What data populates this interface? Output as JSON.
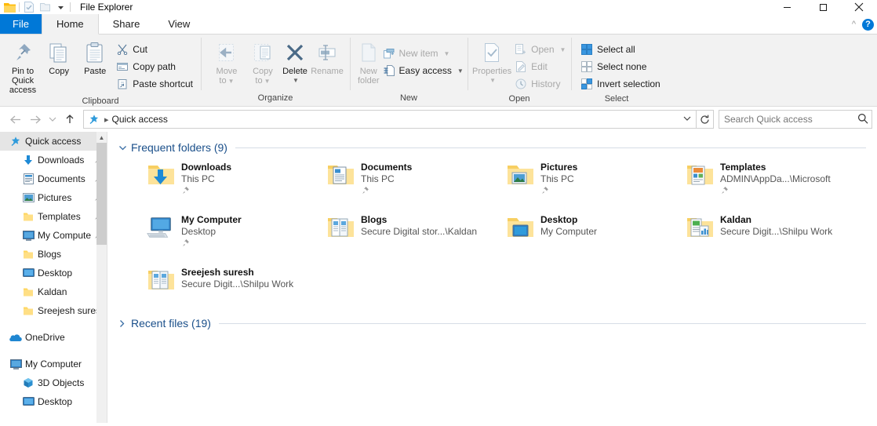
{
  "window": {
    "title": "File Explorer",
    "quick_access_toolbar": [
      {
        "name": "explorer-icon",
        "glyph": "folder"
      },
      {
        "name": "properties-qat-icon",
        "glyph": "check-doc"
      },
      {
        "name": "new-folder-qat-icon",
        "glyph": "folder-blank"
      },
      {
        "name": "customize-qat-icon",
        "glyph": "caret-down"
      }
    ],
    "controls": {
      "minimize": "minimize",
      "maximize": "maximize",
      "close": "close",
      "collapse_ribbon": "chevron-up",
      "help": "?"
    }
  },
  "tabs": [
    {
      "label": "File",
      "state": "file-menu"
    },
    {
      "label": "Home",
      "state": "active"
    },
    {
      "label": "Share",
      "state": "normal"
    },
    {
      "label": "View",
      "state": "normal"
    }
  ],
  "ribbon": {
    "groups": [
      {
        "name": "Clipboard",
        "label": "Clipboard",
        "big_buttons": [
          {
            "label_line1": "Pin to Quick",
            "label_line2": "access",
            "icon": "pin-icon",
            "enabled": true
          },
          {
            "label_line1": "Copy",
            "label_line2": "",
            "icon": "copy-icon",
            "enabled": true
          },
          {
            "label_line1": "Paste",
            "label_line2": "",
            "icon": "paste-icon",
            "enabled": true
          }
        ],
        "small_buttons": [
          {
            "label": "Cut",
            "icon": "scissors-icon",
            "enabled": true,
            "caret": false
          },
          {
            "label": "Copy path",
            "icon": "copy-path-icon",
            "enabled": true,
            "caret": false
          },
          {
            "label": "Paste shortcut",
            "icon": "paste-shortcut-icon",
            "enabled": true,
            "caret": false
          }
        ]
      },
      {
        "name": "Organize",
        "label": "Organize",
        "big_buttons": [
          {
            "label_line1": "Move",
            "label_line2": "to",
            "icon": "move-to-icon",
            "enabled": false,
            "caret": true
          },
          {
            "label_line1": "Copy",
            "label_line2": "to",
            "icon": "copy-to-icon",
            "enabled": false,
            "caret": true
          },
          {
            "label_line1": "Delete",
            "label_line2": "",
            "icon": "delete-icon",
            "enabled": true,
            "caret": true
          },
          {
            "label_line1": "Rename",
            "label_line2": "",
            "icon": "rename-icon",
            "enabled": false,
            "caret": false
          }
        ],
        "small_buttons": []
      },
      {
        "name": "New",
        "label": "New",
        "big_buttons": [
          {
            "label_line1": "New",
            "label_line2": "folder",
            "icon": "new-folder-icon",
            "enabled": false
          }
        ],
        "small_buttons": [
          {
            "label": "New item",
            "icon": "new-item-icon",
            "enabled": false,
            "caret": true
          },
          {
            "label": "Easy access",
            "icon": "easy-access-icon",
            "enabled": true,
            "caret": true
          }
        ]
      },
      {
        "name": "Open",
        "label": "Open",
        "big_buttons": [
          {
            "label_line1": "Properties",
            "label_line2": "",
            "icon": "properties-icon",
            "enabled": false,
            "caret": true
          }
        ],
        "small_buttons": [
          {
            "label": "Open",
            "icon": "open-icon",
            "enabled": false,
            "caret": true
          },
          {
            "label": "Edit",
            "icon": "edit-icon",
            "enabled": false,
            "caret": false
          },
          {
            "label": "History",
            "icon": "history-icon",
            "enabled": false,
            "caret": false
          }
        ]
      },
      {
        "name": "Select",
        "label": "Select",
        "big_buttons": [],
        "small_buttons": [
          {
            "label": "Select all",
            "icon": "select-all-icon",
            "enabled": true,
            "caret": false
          },
          {
            "label": "Select none",
            "icon": "select-none-icon",
            "enabled": true,
            "caret": false
          },
          {
            "label": "Invert selection",
            "icon": "invert-selection-icon",
            "enabled": true,
            "caret": false
          }
        ]
      }
    ]
  },
  "navbar": {
    "back": "back-arrow",
    "forward": "forward-arrow",
    "recent": "chevron-down",
    "up": "up-arrow",
    "address_icon": "quick-access-star-icon",
    "address_text": "Quick access",
    "address_dropdown": "chevron-down",
    "refresh": "refresh-icon",
    "search_placeholder": "Search Quick access",
    "search_value": "",
    "search_icon": "search-icon"
  },
  "sidebar": {
    "items": [
      {
        "label": "Quick access",
        "icon": "quick-access-star-icon",
        "indent": 0,
        "selected": true,
        "pinned": false
      },
      {
        "label": "Downloads",
        "icon": "downloads-icon",
        "indent": 1,
        "selected": false,
        "pinned": true
      },
      {
        "label": "Documents",
        "icon": "documents-icon",
        "indent": 1,
        "selected": false,
        "pinned": true
      },
      {
        "label": "Pictures",
        "icon": "pictures-icon",
        "indent": 1,
        "selected": false,
        "pinned": true
      },
      {
        "label": "Templates",
        "icon": "folder-icon",
        "indent": 1,
        "selected": false,
        "pinned": true
      },
      {
        "label": "My Compute",
        "icon": "monitor-icon",
        "indent": 1,
        "selected": false,
        "pinned": true
      },
      {
        "label": "Blogs",
        "icon": "folder-icon",
        "indent": 1,
        "selected": false,
        "pinned": false
      },
      {
        "label": "Desktop",
        "icon": "desktop-icon",
        "indent": 1,
        "selected": false,
        "pinned": false
      },
      {
        "label": "Kaldan",
        "icon": "folder-icon",
        "indent": 1,
        "selected": false,
        "pinned": false
      },
      {
        "label": "Sreejesh suresh",
        "icon": "folder-icon",
        "indent": 1,
        "selected": false,
        "pinned": false
      },
      {
        "label": "OneDrive",
        "icon": "onedrive-icon",
        "indent": 0,
        "selected": false,
        "pinned": false,
        "gap_before": true
      },
      {
        "label": "My Computer",
        "icon": "monitor-icon",
        "indent": 0,
        "selected": false,
        "pinned": false,
        "gap_before": true
      },
      {
        "label": "3D Objects",
        "icon": "3d-objects-icon",
        "indent": 1,
        "selected": false,
        "pinned": false
      },
      {
        "label": "Desktop",
        "icon": "desktop-icon",
        "indent": 1,
        "selected": false,
        "pinned": false
      }
    ],
    "scrollbar": {
      "up_arrow": "chevron-up",
      "thumb": "scroll-thumb"
    }
  },
  "main": {
    "frequent": {
      "header": "Frequent folders (9)",
      "expanded": true,
      "chevron": "chevron-down",
      "items": [
        {
          "name": "Downloads",
          "sub": "This PC",
          "icon": "downloads-folder-icon",
          "pinned": true
        },
        {
          "name": "Documents",
          "sub": "This PC",
          "icon": "documents-folder-icon",
          "pinned": true
        },
        {
          "name": "Pictures",
          "sub": "This PC",
          "icon": "pictures-folder-icon",
          "pinned": true
        },
        {
          "name": "Templates",
          "sub": "ADMIN\\AppDa...\\Microsoft",
          "icon": "templates-folder-icon",
          "pinned": true
        },
        {
          "name": "My Computer",
          "sub": "Desktop",
          "icon": "computer-icon",
          "pinned": true
        },
        {
          "name": "Blogs",
          "sub": "Secure Digital stor...\\Kaldan",
          "icon": "docs-folder-icon",
          "pinned": false
        },
        {
          "name": "Desktop",
          "sub": "My Computer",
          "icon": "desktop-folder-icon",
          "pinned": false
        },
        {
          "name": "Kaldan",
          "sub": "Secure Digit...\\Shilpu Work",
          "icon": "sheets-folder-icon",
          "pinned": false
        },
        {
          "name": "Sreejesh suresh",
          "sub": "Secure Digit...\\Shilpu Work",
          "icon": "docs-folder-icon",
          "pinned": false
        }
      ]
    },
    "recent": {
      "header": "Recent files (19)",
      "expanded": false,
      "chevron": "chevron-right"
    }
  },
  "colors": {
    "accent": "#0078d7",
    "section_heading": "#1a4f8a",
    "ribbon_bg": "#f2f2f2",
    "selection": "#e5e5e5",
    "folder_yellow": "#ffd65c",
    "disabled_text": "#a8a8a8"
  }
}
